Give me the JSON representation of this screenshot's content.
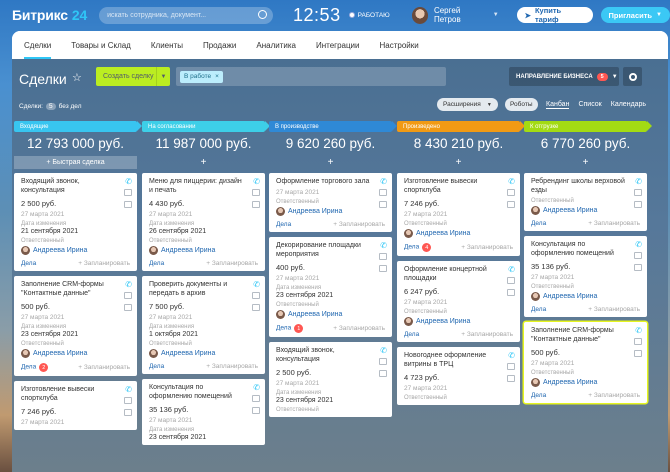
{
  "topbar": {
    "logo": "Битрикс",
    "logo_num": "24",
    "search_placeholder": "искать сотрудника, документ...",
    "time": "12:53",
    "work_status": "РАБОТАЮ",
    "user_name": "Сергей Петров",
    "buy_label": "Купить тариф",
    "invite_label": "Пригласить"
  },
  "tabs": [
    "Сделки",
    "Товары и Склад",
    "Клиенты",
    "Продажи",
    "Аналитика",
    "Интеграции",
    "Настройки"
  ],
  "toolbar": {
    "title": "Сделки",
    "add_label": "Создать сделку",
    "filter_tag": "В работе",
    "direction_label": "НАПРАВЛЕНИЕ БИЗНЕСА",
    "direction_count": "5"
  },
  "subbar": {
    "label": "Сделки:",
    "count": "5",
    "suffix": "без дел",
    "ext_label": "Расширения",
    "robots_label": "Роботы",
    "views": [
      "Канбан",
      "Список",
      "Календарь"
    ]
  },
  "colors": {
    "accent": "#2fc6f6",
    "add": "#bbed21",
    "link": "#2067b0",
    "badge": "#ff5752"
  },
  "columns": [
    {
      "stage": "Входящие",
      "sum": "12 793 000 руб.",
      "quick": "+ Быстрая сделка",
      "cards": [
        {
          "title": "Входящий звонок, консультация",
          "price": "2 500 руб.",
          "date": "27 марта 2021",
          "mod_label": "Дата изменения",
          "mod_date": "21 сентября 2021",
          "resp_label": "Ответственный",
          "resp": "Андреева Ирина",
          "deals": "Дела",
          "badge": "",
          "plan": "+ Запланировать"
        },
        {
          "title": "Заполнение CRM-формы \"Контактные данные\"",
          "price": "500 руб.",
          "date": "27 марта 2021",
          "mod_label": "Дата изменения",
          "mod_date": "23 сентября 2021",
          "resp_label": "Ответственный",
          "resp": "Андреева Ирина",
          "deals": "Дела",
          "badge": "2",
          "plan": "+ Запланировать"
        },
        {
          "title": "Изготовление вывески спортклуба",
          "price": "7 246 руб.",
          "date": "27 марта 2021",
          "mod_label": "",
          "mod_date": "",
          "resp_label": "",
          "resp": "",
          "deals": "",
          "badge": "",
          "plan": ""
        }
      ]
    },
    {
      "stage": "На согласовании",
      "sum": "11 987 000 руб.",
      "quick": "+",
      "cards": [
        {
          "title": "Меню для пиццерии: дизайн и печать",
          "price": "4 430 руб.",
          "date": "27 марта 2021",
          "mod_label": "Дата изменения",
          "mod_date": "26 сентября 2021",
          "resp_label": "Ответственный",
          "resp": "Андреева Ирина",
          "deals": "Дела",
          "badge": "",
          "plan": "+ Запланировать"
        },
        {
          "title": "Проверить документы и передать в архив",
          "price": "7 500 руб.",
          "date": "27 марта 2021",
          "mod_label": "Дата изменения",
          "mod_date": "1 октября 2021",
          "resp_label": "Ответственный",
          "resp": "Андреева Ирина",
          "deals": "Дела",
          "badge": "",
          "plan": "+ Запланировать"
        },
        {
          "title": "Консультация по оформлению помещений",
          "price": "35 136 руб.",
          "date": "27 марта 2021",
          "mod_label": "Дата изменения",
          "mod_date": "23 сентября 2021",
          "resp_label": "",
          "resp": "",
          "deals": "",
          "badge": "",
          "plan": ""
        }
      ]
    },
    {
      "stage": "В производстве",
      "sum": "9 620 260 руб.",
      "quick": "+",
      "cards": [
        {
          "title": "Оформление торгового зала",
          "price": "",
          "date": "27 марта 2021",
          "mod_label": "",
          "mod_date": "",
          "resp_label": "Ответственный",
          "resp": "Андреева Ирина",
          "deals": "Дела",
          "badge": "",
          "plan": "+ Запланировать"
        },
        {
          "title": "Декорирование площадки мероприятия",
          "price": "400 руб.",
          "date": "27 марта 2021",
          "mod_label": "Дата изменения",
          "mod_date": "23 сентября 2021",
          "resp_label": "Ответственный",
          "resp": "Андреева Ирина",
          "deals": "Дела",
          "badge": "1",
          "plan": "+ Запланировать"
        },
        {
          "title": "Входящий звонок, консультация",
          "price": "2 500 руб.",
          "date": "27 марта 2021",
          "mod_label": "Дата изменения",
          "mod_date": "23 сентября 2021",
          "resp_label": "Ответственный",
          "resp": "",
          "deals": "",
          "badge": "",
          "plan": ""
        }
      ]
    },
    {
      "stage": "Произведено",
      "sum": "8 430 210 руб.",
      "quick": "+",
      "cards": [
        {
          "title": "Изготовление вывески спортклуба",
          "price": "7 246 руб.",
          "date": "27 марта 2021",
          "mod_label": "",
          "mod_date": "",
          "resp_label": "Ответственный",
          "resp": "Андреева Ирина",
          "deals": "Дела",
          "badge": "4",
          "plan": "+ Запланировать"
        },
        {
          "title": "Оформление концертной площадки",
          "price": "6 247 руб.",
          "date": "27 марта 2021",
          "mod_label": "",
          "mod_date": "",
          "resp_label": "Ответственный",
          "resp": "Андреева Ирина",
          "deals": "Дела",
          "badge": "",
          "plan": "+ Запланировать"
        },
        {
          "title": "Новогоднее оформление витрины в ТРЦ",
          "price": "4 723 руб.",
          "date": "27 марта 2021",
          "mod_label": "",
          "mod_date": "",
          "resp_label": "Ответственный",
          "resp": "",
          "deals": "",
          "badge": "",
          "plan": ""
        }
      ]
    },
    {
      "stage": "К отгрузке",
      "sum": "6 770 260 руб.",
      "quick": "+",
      "cards": [
        {
          "title": "Ребрендинг школы верховой езды",
          "price": "",
          "date": "",
          "mod_label": "",
          "mod_date": "",
          "resp_label": "Ответственный",
          "resp": "Андреева Ирина",
          "deals": "Дела",
          "badge": "",
          "plan": "+ Запланировать"
        },
        {
          "title": "Консультация по оформлению помещений",
          "price": "35 136 руб.",
          "date": "27 марта 2021",
          "mod_label": "",
          "mod_date": "",
          "resp_label": "Ответственный",
          "resp": "Андреева Ирина",
          "deals": "Дела",
          "badge": "",
          "plan": "+ Запланировать"
        },
        {
          "title": "Заполнение CRM-формы \"Контактные данные\"",
          "price": "500 руб.",
          "date": "27 марта 2021",
          "mod_label": "",
          "mod_date": "",
          "resp_label": "Ответственный",
          "resp": "Андреева Ирина",
          "deals": "Дела",
          "badge": "",
          "plan": "+ Запланировать"
        }
      ]
    }
  ]
}
